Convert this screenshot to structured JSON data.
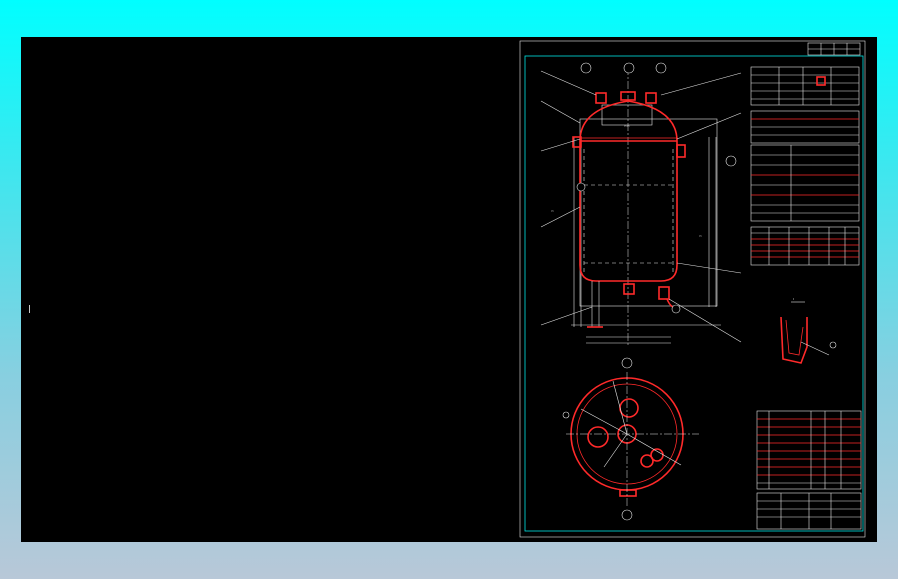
{
  "window": {
    "title": "",
    "background_gradient": [
      "#00ffff",
      "#b8c8d8"
    ],
    "canvas_color": "#000000"
  },
  "drawing": {
    "line_color": "#e6e6e6",
    "vessel_color": "#ff2a2a",
    "frame_color": "#00e5e5",
    "section_label": "I"
  }
}
